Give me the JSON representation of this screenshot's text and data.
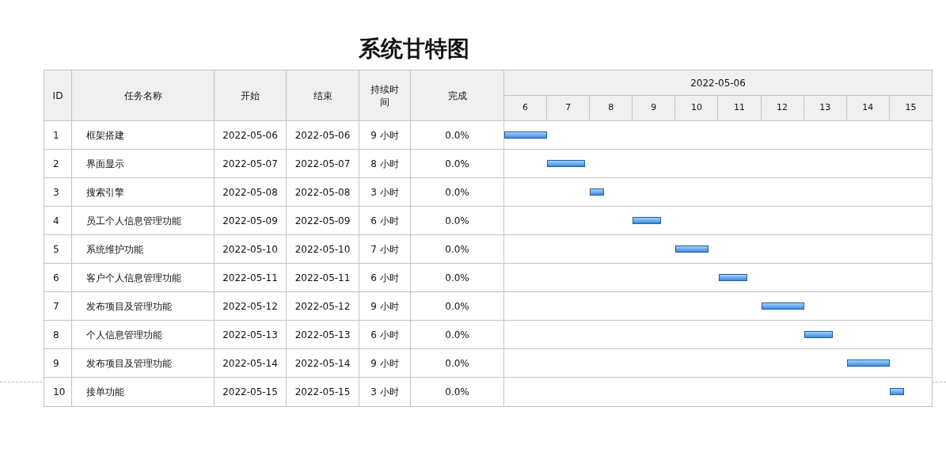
{
  "title": "系统甘特图",
  "columns": [
    "ID",
    "任务名称",
    "开始",
    "结束",
    "持续时间",
    "完成"
  ],
  "timeline": {
    "date": "2022-05-06",
    "days": [
      "6",
      "7",
      "8",
      "9",
      "10",
      "11",
      "12",
      "13",
      "14",
      "15"
    ]
  },
  "tasks": [
    {
      "id": "1",
      "name": "框架搭建",
      "start": "2022-05-06",
      "end": "2022-05-06",
      "duration": "9 小时",
      "complete": "0.0%"
    },
    {
      "id": "2",
      "name": "界面显示",
      "start": "2022-05-07",
      "end": "2022-05-07",
      "duration": "8 小时",
      "complete": "0.0%"
    },
    {
      "id": "3",
      "name": "搜索引擎",
      "start": "2022-05-08",
      "end": "2022-05-08",
      "duration": "3 小时",
      "complete": "0.0%"
    },
    {
      "id": "4",
      "name": "员工个人信息管理功能",
      "start": "2022-05-09",
      "end": "2022-05-09",
      "duration": "6 小时",
      "complete": "0.0%"
    },
    {
      "id": "5",
      "name": "系统维护功能",
      "start": "2022-05-10",
      "end": "2022-05-10",
      "duration": "7 小时",
      "complete": "0.0%"
    },
    {
      "id": "6",
      "name": "客户个人信息管理功能",
      "start": "2022-05-11",
      "end": "2022-05-11",
      "duration": "6 小时",
      "complete": "0.0%"
    },
    {
      "id": "7",
      "name": "发布项目及管理功能",
      "start": "2022-05-12",
      "end": "2022-05-12",
      "duration": "9 小时",
      "complete": "0.0%"
    },
    {
      "id": "8",
      "name": "个人信息管理功能",
      "start": "2022-05-13",
      "end": "2022-05-13",
      "duration": "6 小时",
      "complete": "0.0%"
    },
    {
      "id": "9",
      "name": "发布项目及管理功能",
      "start": "2022-05-14",
      "end": "2022-05-14",
      "duration": "9 小时",
      "complete": "0.0%"
    },
    {
      "id": "10",
      "name": "接单功能",
      "start": "2022-05-15",
      "end": "2022-05-15",
      "duration": "3 小时",
      "complete": "0.0%"
    }
  ]
}
